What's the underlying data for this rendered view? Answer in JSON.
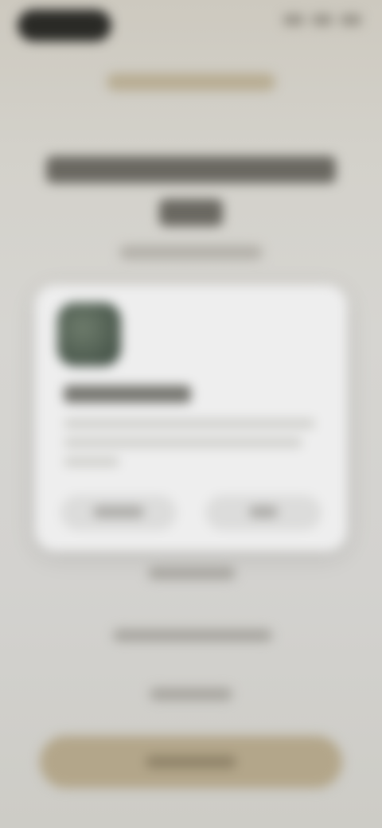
{
  "screen": {
    "note_state": "blurred",
    "status_bar": {
      "left_indicator": "",
      "right_indicators": [
        "",
        "",
        ""
      ]
    },
    "top_banner_label": "",
    "headline": "",
    "subheadline": "",
    "card": {
      "app_icon": "app-icon",
      "title": "",
      "description": "",
      "left_button_label": "",
      "right_button_label": ""
    },
    "links": [
      "",
      "",
      ""
    ],
    "primary_button_label": ""
  },
  "colors": {
    "background": "#d6d5d1",
    "card": "#eeeeee",
    "accent": "#b3a68a",
    "status_pill": "#2a2a26"
  }
}
